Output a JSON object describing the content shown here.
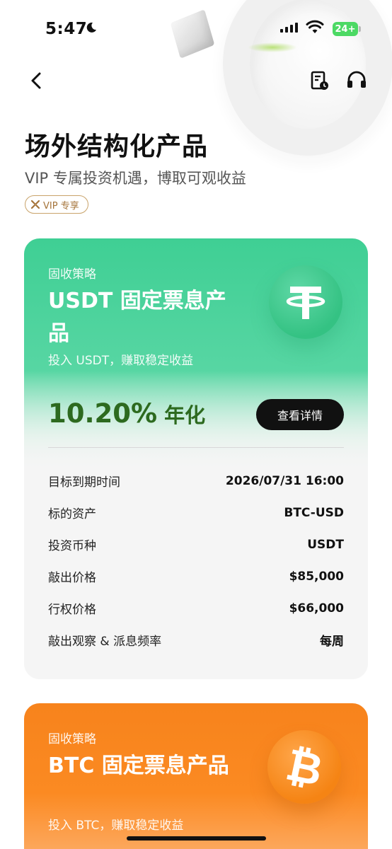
{
  "status_bar": {
    "time": "5:47",
    "battery": "24+",
    "colors": {
      "battery": "#4cd964"
    }
  },
  "nav": {
    "back_icon": "chevron-left-icon",
    "doc_icon": "document-clock-icon",
    "support_icon": "headset-icon"
  },
  "header": {
    "title": "场外结构化产品",
    "subtitle": "VIP 专属投资机遇，博取可观收益",
    "vip_badge": "VIP 专享"
  },
  "products": [
    {
      "tag": "固收策略",
      "title": "USDT 固定票息产品",
      "description": "投入 USDT，赚取稳定收益",
      "coin_icon": "tether-icon",
      "rate": "10.20%",
      "rate_unit": "年化",
      "button_label": "查看详情",
      "details": [
        {
          "label": "目标到期时间",
          "value": "2026/07/31 16:00"
        },
        {
          "label": "标的资产",
          "value": "BTC-USD"
        },
        {
          "label": "投资币种",
          "value": "USDT"
        },
        {
          "label": "敲出价格",
          "value": "$85,000"
        },
        {
          "label": "行权价格",
          "value": "$66,000"
        },
        {
          "label": "敲出观察 & 派息频率",
          "value": "每周"
        }
      ],
      "colors": {
        "accent": "#3fcf94",
        "rate": "#2d6a1f"
      }
    },
    {
      "tag": "固收策略",
      "title": "BTC 固定票息产品",
      "description": "投入 BTC，赚取稳定收益",
      "coin_icon": "bitcoin-icon",
      "colors": {
        "accent": "#f7831c"
      }
    }
  ]
}
